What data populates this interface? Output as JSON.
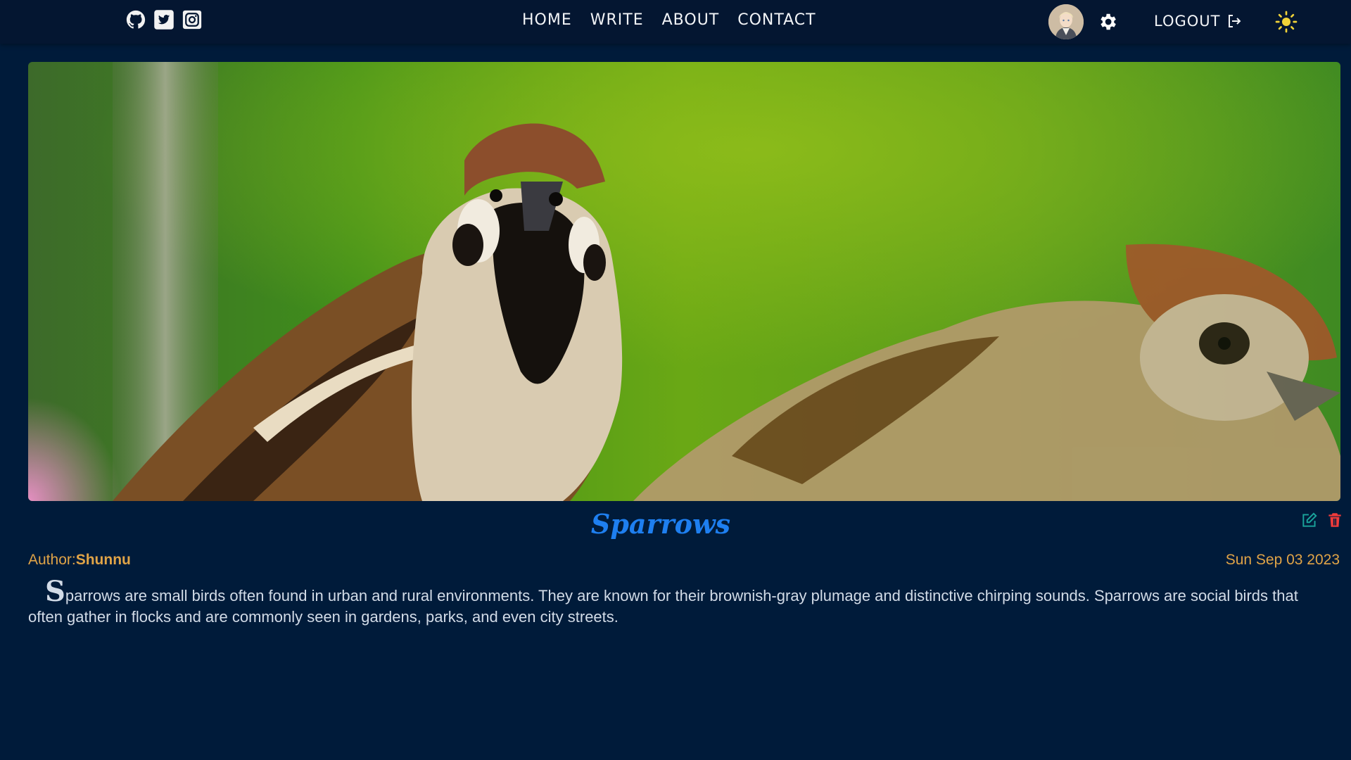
{
  "header": {
    "social_icons": [
      "github-icon",
      "twitter-icon",
      "instagram-icon"
    ],
    "nav": [
      {
        "label": "HOME"
      },
      {
        "label": "WRITE"
      },
      {
        "label": "ABOUT"
      },
      {
        "label": "CONTACT"
      }
    ],
    "logout_label": "LOGOUT",
    "icons": {
      "settings": "gear-icon",
      "logout": "logout-icon",
      "theme": "sun-icon"
    }
  },
  "post": {
    "title": "Sparrows",
    "author_prefix": "Author:",
    "author": "Shunnu",
    "date": "Sun Sep 03 2023",
    "first_letter": "S",
    "body_rest": "parrows are small birds often found in urban and rural environments. They are known for their brownish-gray plumage and distinctive chirping sounds. Sparrows are social birds that often gather in flocks and are commonly seen in gardens, parks, and even city streets."
  },
  "colors": {
    "background": "#001b3a",
    "topbar": "#041631",
    "title": "#1e7ff0",
    "meta": "#e0a447",
    "edit": "#1aa39b",
    "delete": "#f03b3b",
    "sun": "#f1d338"
  }
}
